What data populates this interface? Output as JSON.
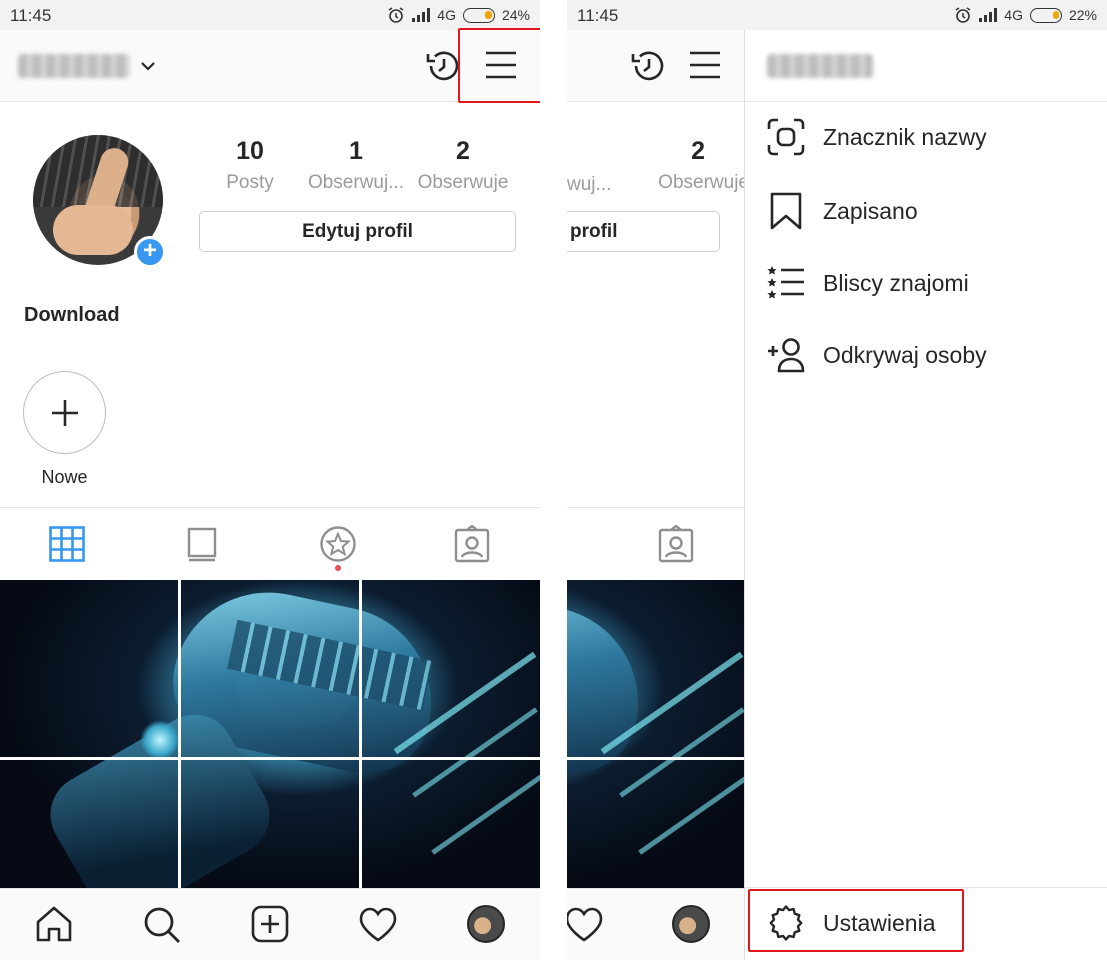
{
  "status_left": {
    "time": "11:45",
    "network": "4G",
    "battery": "24%"
  },
  "status_right": {
    "time": "11:45",
    "network": "4G",
    "battery": "22%"
  },
  "profile": {
    "posts_count": "10",
    "posts_label": "Posty",
    "followers_count": "1",
    "followers_label": "Obserwuj...",
    "following_count": "2",
    "following_label": "Obserwuje",
    "edit_button": "Edytuj profil",
    "edit_button_partial": "profil",
    "followers_label_partial": "wuj...",
    "display_name": "Download",
    "new_highlight_label": "Nowe"
  },
  "drawer": {
    "items": [
      {
        "label": "Znacznik nazwy",
        "icon": "nametag-icon"
      },
      {
        "label": "Zapisano",
        "icon": "bookmark-icon"
      },
      {
        "label": "Bliscy znajomi",
        "icon": "close-friends-icon"
      },
      {
        "label": "Odkrywaj osoby",
        "icon": "add-person-icon"
      }
    ],
    "settings_label": "Ustawienia"
  },
  "colors": {
    "accent_blue": "#3897f0",
    "highlight_red": "#e0181b",
    "notification_dot": "#ed4956"
  }
}
